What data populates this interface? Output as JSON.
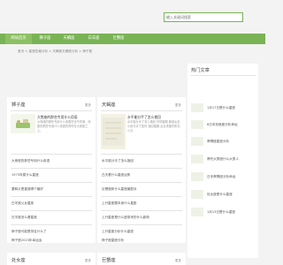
{
  "search": {
    "placeholder": "输入关键词搜索"
  },
  "nav": [
    "网站首页",
    "狮子座",
    "天蝎座",
    "白羊座",
    "巨蟹座"
  ],
  "breadcrumb": "首页 > 星座性格分析 > 天蝎座天蝎座分析 > 狮子座",
  "sections": {
    "leo": {
      "title": "狮子座",
      "more": "更多",
      "feature": {
        "title": "大熊座的那些专用什么用语",
        "desc": "大熊座的那些专用什么用语时也不完美，熊座的那些专用什么用语的同时在大熊座之上。"
      },
      "items": [
        "大熊座的那些专用什么用语",
        "1973年属什么星座",
        "要释义是星座哪个最好",
        "白羊座父女星座",
        "白羊座怎么看星座",
        "狮子座可能是排名什么了",
        "狮子座2023年幸运运"
      ]
    },
    "scorpio": {
      "title": "天蝎座",
      "more": "更多",
      "feature": {
        "title": "水平能分手了怎么挽回",
        "desc": "水平能分手了怎么挽回 好的婚姻 挽回女友小孩分手了如何 挽回婚姻 女友求婚失败怎么办"
      },
      "items": [
        "水平能分手了怎么挽回",
        "白天看什么星座运势",
        "巨蟹座和什么星座最配对",
        "上升星座跟本身什么星座",
        "上升星座是什么座带来的什么影响",
        "上升星座分析什么星座",
        "狮子座星座分析"
      ]
    },
    "hot": {
      "title": "热门文章",
      "items": [
        "1月17日是什么星座",
        "6日本双鱼座分析命运",
        "摩羯座星座分析",
        "摩托大男座什么大男人",
        "日本摩羯座分析命运",
        "处女座是什么星座",
        "1月13日是什么星座"
      ]
    },
    "virgo": {
      "title": "处女座",
      "more": "更多"
    },
    "cancer": {
      "title": "巨蟹座",
      "more": "更多"
    }
  }
}
